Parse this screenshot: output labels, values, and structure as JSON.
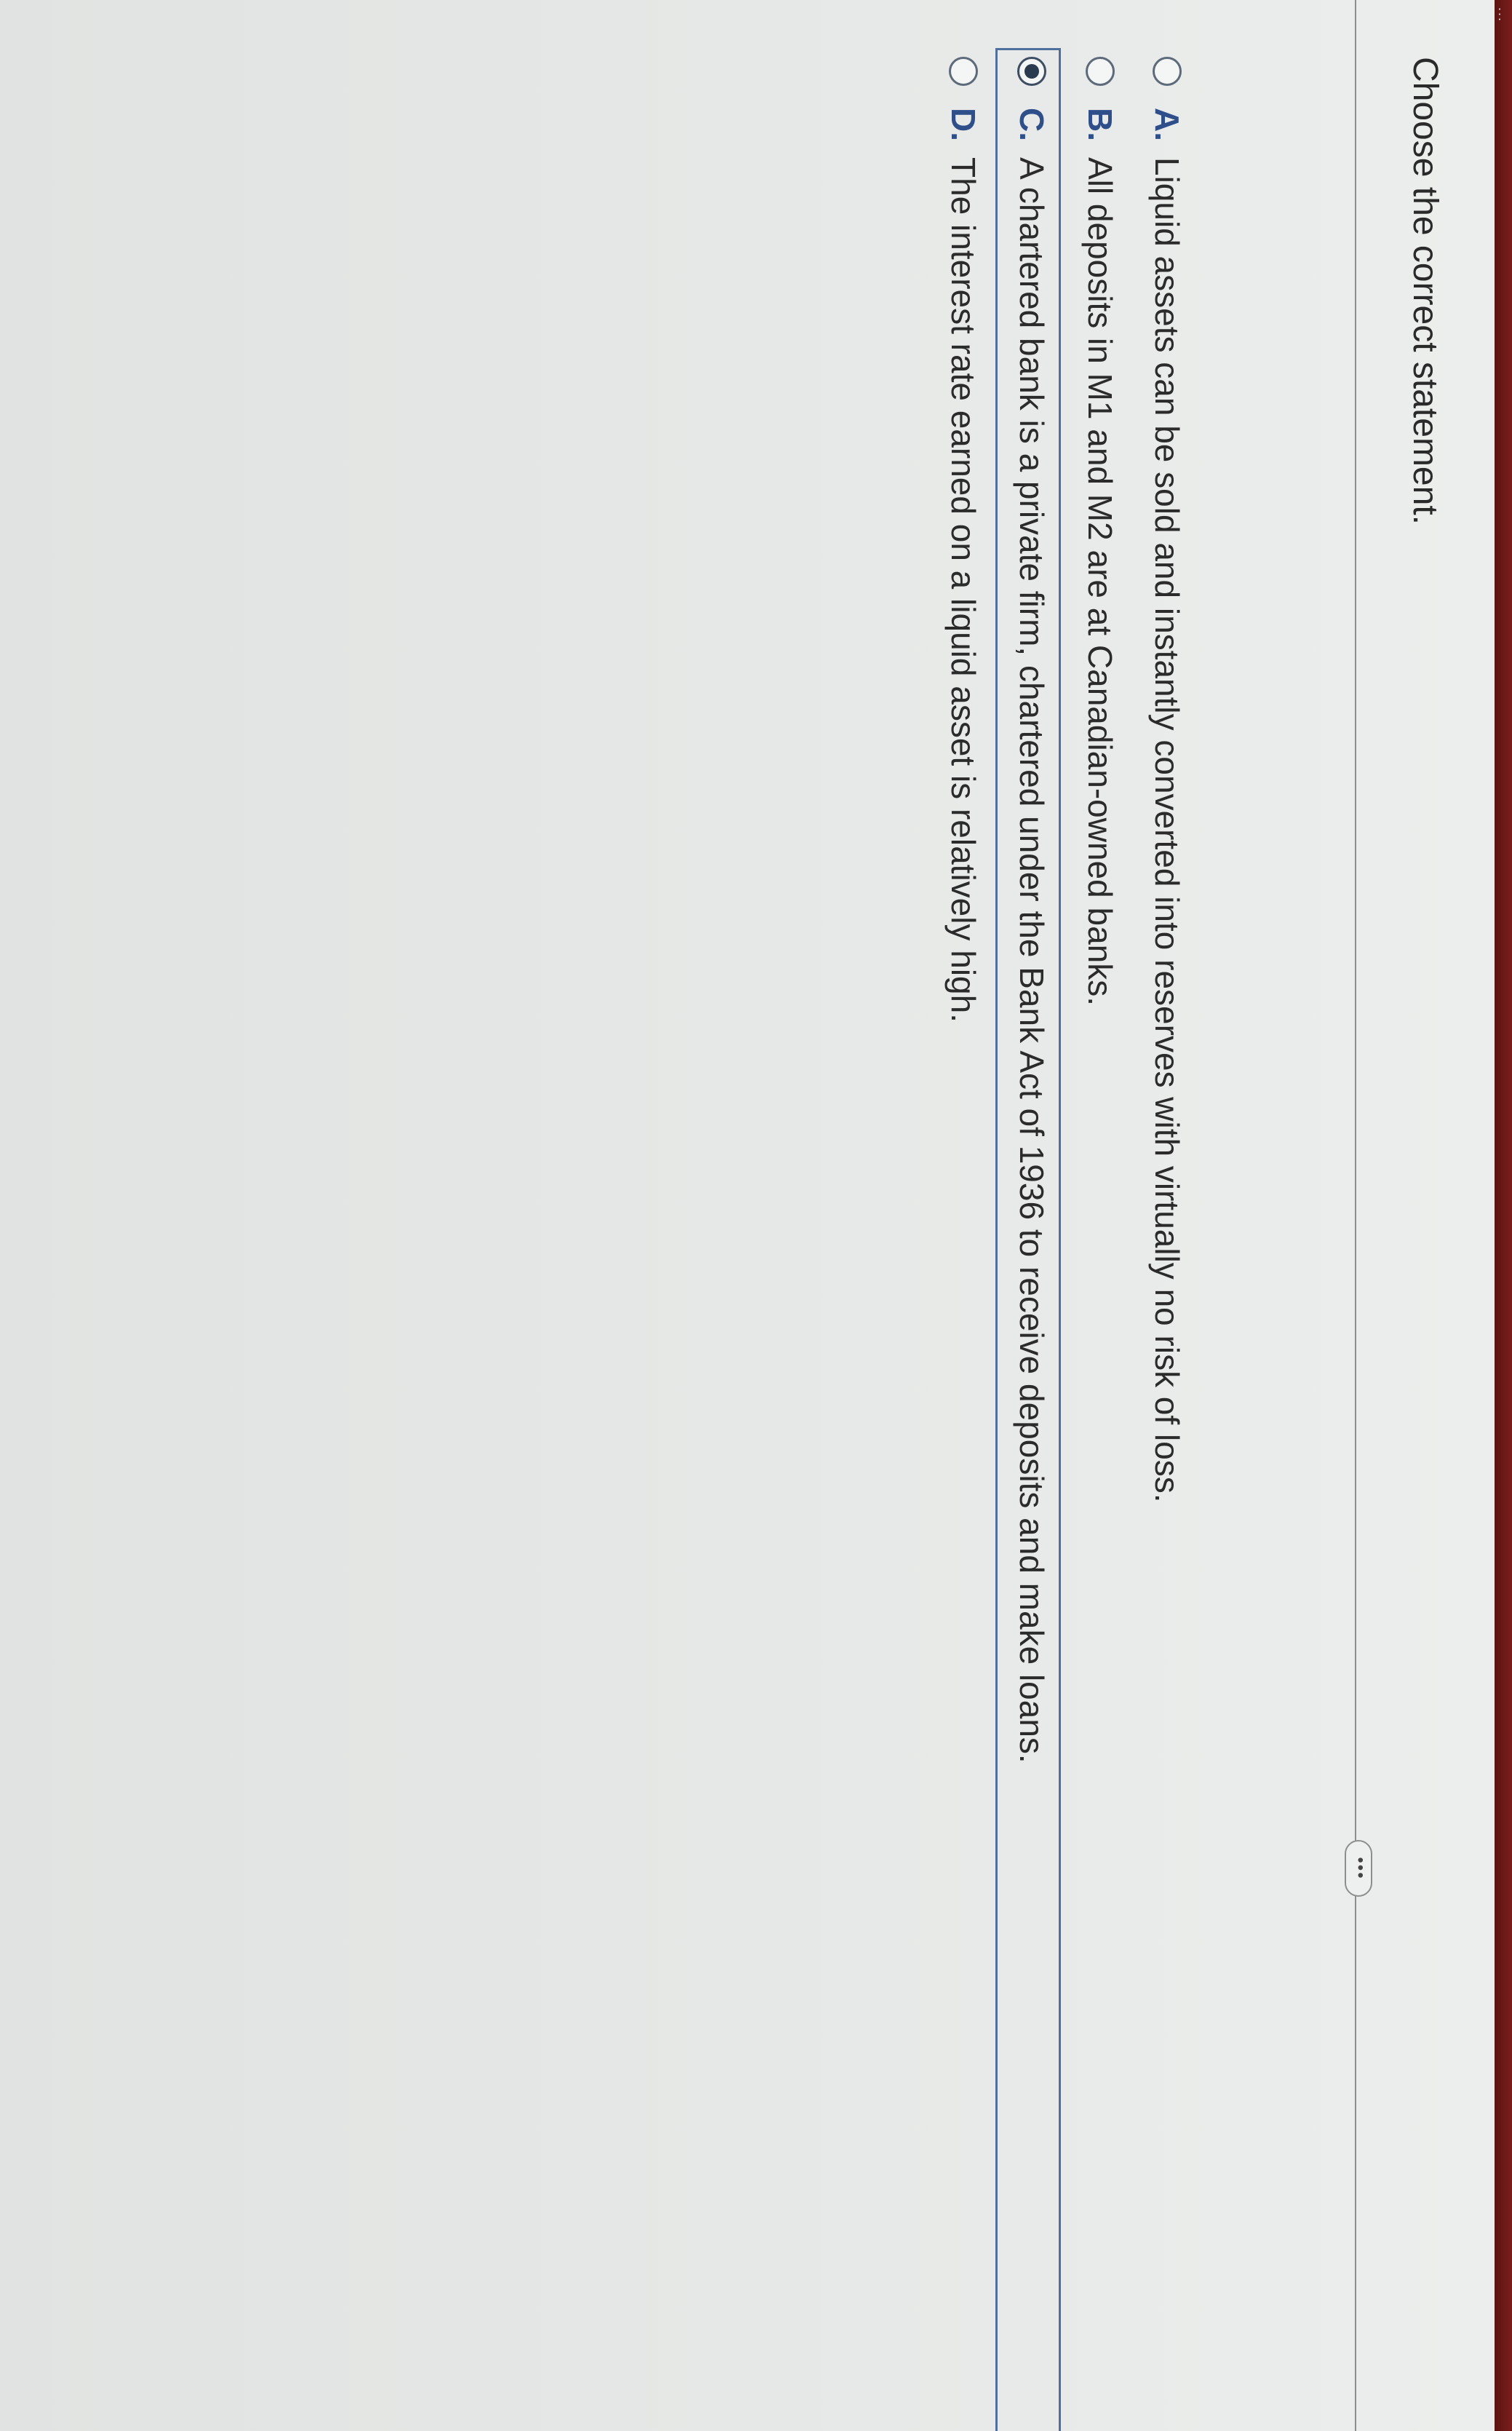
{
  "question": {
    "prompt": "Choose the correct statement."
  },
  "more_button": {
    "label": "•••"
  },
  "edge": {
    "text": "..."
  },
  "options": [
    {
      "letter": "A.",
      "text": "Liquid assets can be sold and instantly converted into reserves with virtually no risk of loss.",
      "selected": false
    },
    {
      "letter": "B.",
      "text": "All deposits in M1 and M2 are at Canadian-owned banks.",
      "selected": false
    },
    {
      "letter": "C.",
      "text": "A chartered bank is a private firm, chartered under the Bank Act of 1936 to receive deposits and make loans.",
      "selected": true
    },
    {
      "letter": "D.",
      "text": "The interest rate earned on a liquid asset is relatively high.",
      "selected": false
    }
  ],
  "colors": {
    "accent": "#2f4f8a",
    "selection_border": "#4f6f9c",
    "edge_bar": "#7a1e1c"
  }
}
